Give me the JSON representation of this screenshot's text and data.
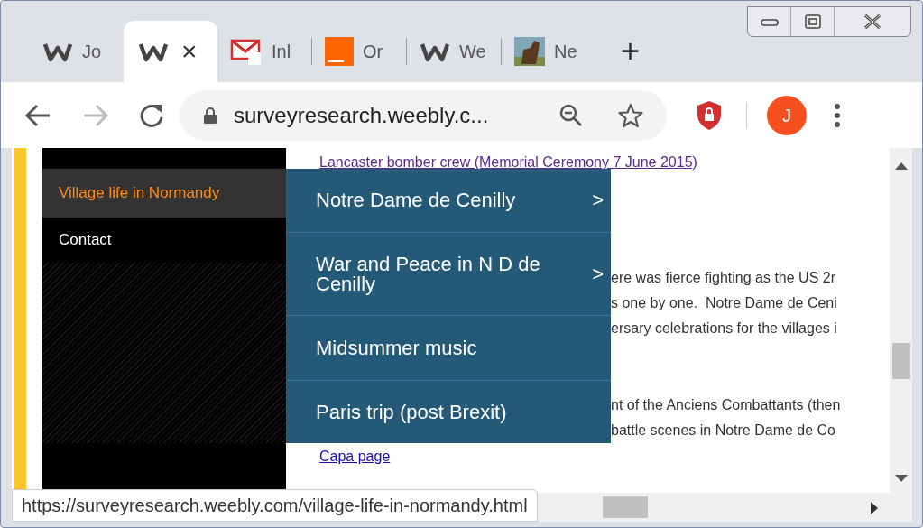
{
  "tabs": [
    {
      "kind": "w-logo",
      "label": "Jo",
      "selected": false
    },
    {
      "kind": "w-logo",
      "selected": true
    },
    {
      "kind": "mail",
      "label": "Inl",
      "selected": false
    },
    {
      "kind": "orange",
      "label": "Or",
      "selected": false
    },
    {
      "kind": "w-logo",
      "label": "We",
      "selected": false
    },
    {
      "kind": "photo",
      "label": "Ne",
      "selected": false
    }
  ],
  "tab_close": "×",
  "new_tab": "+",
  "address_bar": {
    "url": "surveyresearch.weebly.c..."
  },
  "profile": {
    "initial": "J"
  },
  "sidebar": {
    "items": [
      {
        "label": "Village life in Normandy",
        "selected": true
      },
      {
        "label": "Contact",
        "selected": false
      }
    ]
  },
  "content": {
    "top_link": "Lancaster bomber crew (Memorial Ceremony 7 June 2015)",
    "lines_upper": [
      "ere was fierce fighting as the US 2r",
      "s one by one.  Notre Dame de Ceni",
      "ersary celebrations for the villages i"
    ],
    "lines_lower": [
      "nt of the Anciens Combattants (then",
      "battle scenes in Notre Dame de Co"
    ],
    "bottom_link": "Capa page"
  },
  "dropdown_menu": [
    {
      "label": "Notre Dame de Cenilly",
      "submenu": true
    },
    {
      "label": "War and Peace in N D de Cenilly",
      "submenu": true
    },
    {
      "label": "Midsummer music",
      "submenu": false
    },
    {
      "label": "Paris trip (post Brexit)",
      "submenu": false
    }
  ],
  "submenu_mark": ">",
  "status_bubble": "https://surveyresearch.weebly.com/village-life-in-normandy.html"
}
